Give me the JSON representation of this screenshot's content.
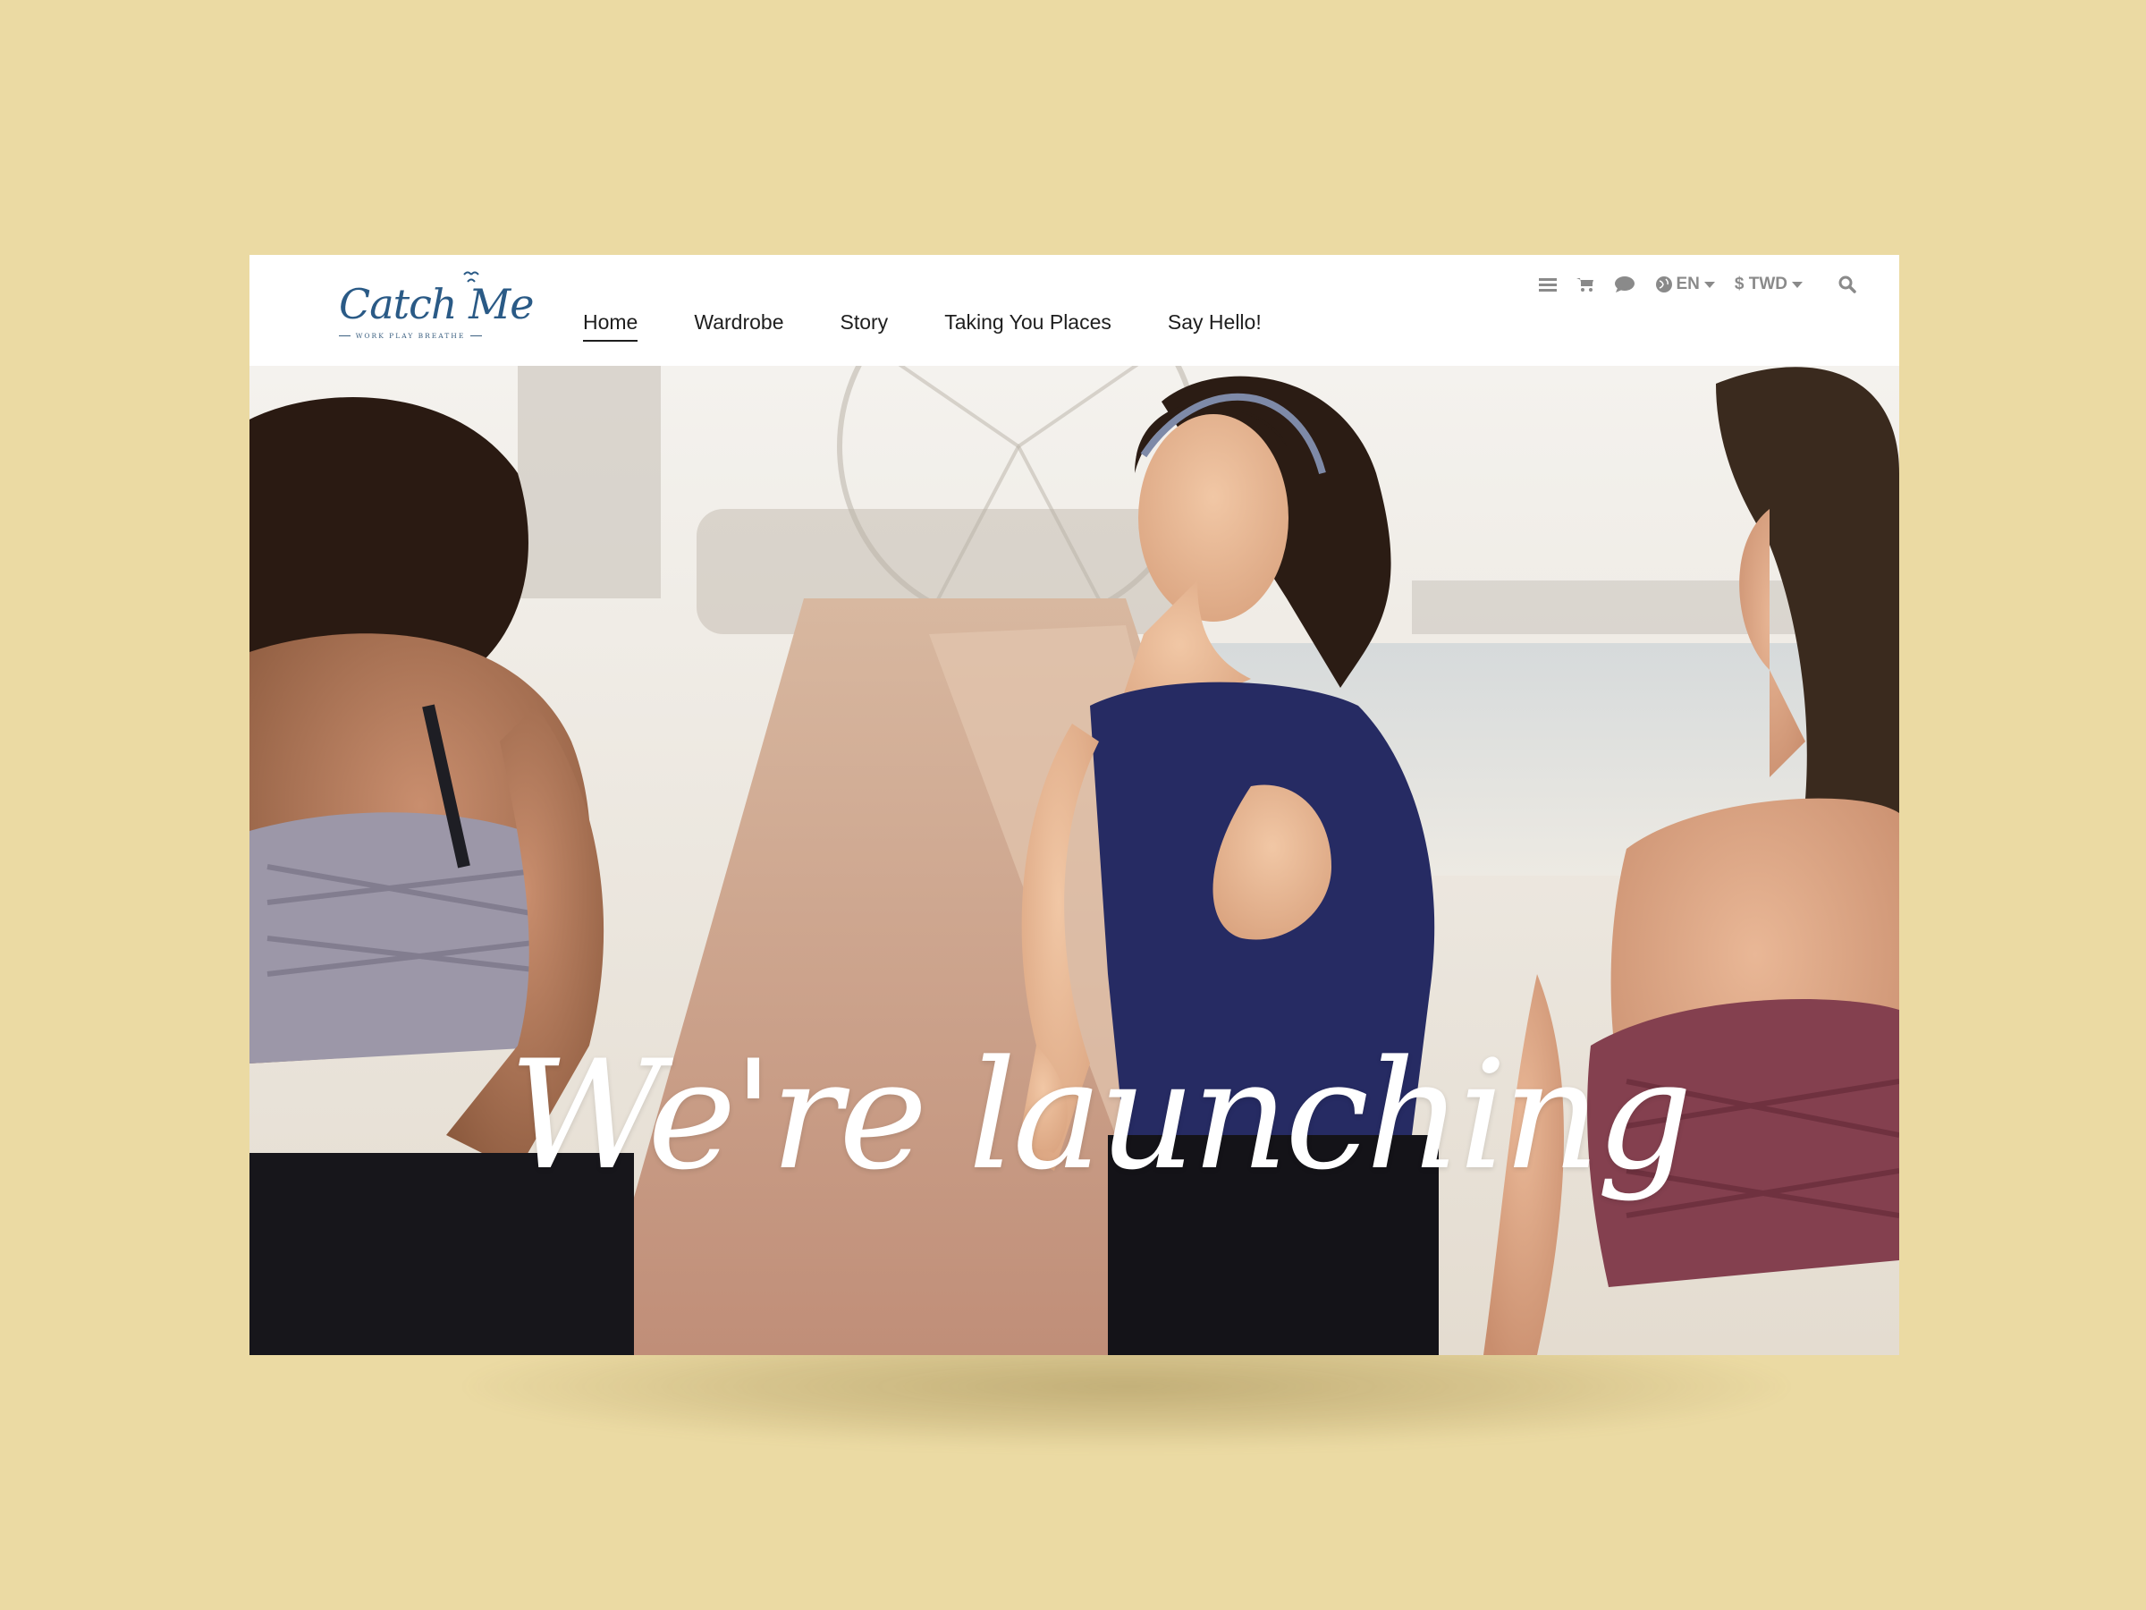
{
  "brand": {
    "name": "Catch Me",
    "tagline": "WORK  PLAY  BREATHE"
  },
  "nav": {
    "items": [
      {
        "label": "Home",
        "active": true
      },
      {
        "label": "Wardrobe",
        "active": false
      },
      {
        "label": "Story",
        "active": false
      },
      {
        "label": "Taking You Places",
        "active": false
      },
      {
        "label": "Say Hello!",
        "active": false
      }
    ]
  },
  "utility": {
    "menu_icon": "list-icon",
    "cart_icon": "cart-icon",
    "chat_icon": "chat-bubble-icon",
    "language": {
      "icon": "globe-icon",
      "label": "EN"
    },
    "currency": {
      "label": "$ TWD"
    },
    "search_icon": "search-icon"
  },
  "hero": {
    "headline": "We're launching"
  },
  "colors": {
    "background": "#EBDAA3",
    "brand_blue": "#2A5A86",
    "nav_text": "#1E1E1E",
    "utility_gray": "#8A8A8A",
    "headline": "#FFFFFF"
  }
}
